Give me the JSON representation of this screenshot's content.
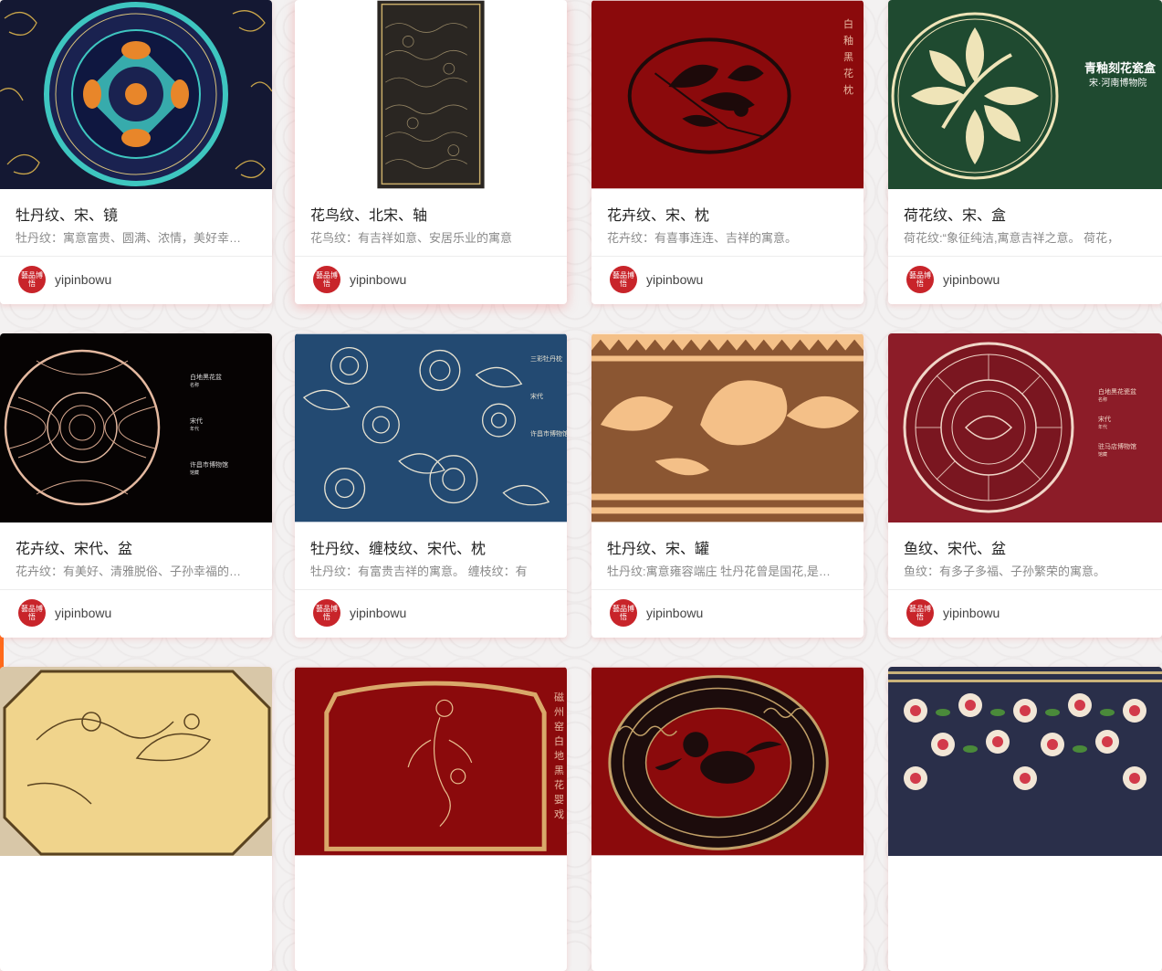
{
  "author": {
    "name": "yipinbowu",
    "avatar_text": "藝品博悟"
  },
  "cards": [
    {
      "title": "牡丹纹、宋、镜",
      "desc": "牡丹纹：寓意富贵、圆满、浓情，美好幸福。"
    },
    {
      "title": "花鸟纹、北宋、轴",
      "desc": "花鸟纹：有吉祥如意、安居乐业的寓意"
    },
    {
      "title": "花卉纹、宋、枕",
      "desc": "花卉纹：有喜事连连、吉祥的寓意。",
      "image_text": "白釉黑花枕"
    },
    {
      "title": "荷花纹、宋、盒",
      "desc": "荷花纹:“象征纯洁,寓意吉祥之意。 荷花，",
      "image_title": "青釉刻花瓷盒",
      "image_subtitle": "宋·河南博物院"
    },
    {
      "title": "花卉纹、宋代、盆",
      "desc": "花卉纹：有美好、清雅脱俗、子孙幸福的寓意。",
      "image_lines": [
        "白地黑花盆",
        "名称",
        "宋代",
        "年代",
        "许昌市博物馆",
        "馆藏"
      ]
    },
    {
      "title": "牡丹纹、缠枝纹、宋代、枕",
      "desc": "牡丹纹：有富贵吉祥的寓意。 缠枝纹：有",
      "image_lines": [
        "三彩牡丹枕",
        "宋代",
        "许昌市博物馆"
      ]
    },
    {
      "title": "牡丹纹、宋、罐",
      "desc": "牡丹纹:寓意雍容端庄 牡丹花曾是国花,是富贵"
    },
    {
      "title": "鱼纹、宋代、盆",
      "desc": "鱼纹：有多子多福、子孙繁荣的寓意。",
      "image_lines": [
        "白地黑花瓷盆",
        "名称",
        "宋代",
        "年代",
        "驻马店博物馆",
        "馆藏"
      ]
    },
    {
      "title": "",
      "desc": ""
    },
    {
      "title": "",
      "desc": "",
      "image_text": "磁州窑白地黑花婴戏"
    },
    {
      "title": "",
      "desc": ""
    },
    {
      "title": "",
      "desc": ""
    }
  ]
}
